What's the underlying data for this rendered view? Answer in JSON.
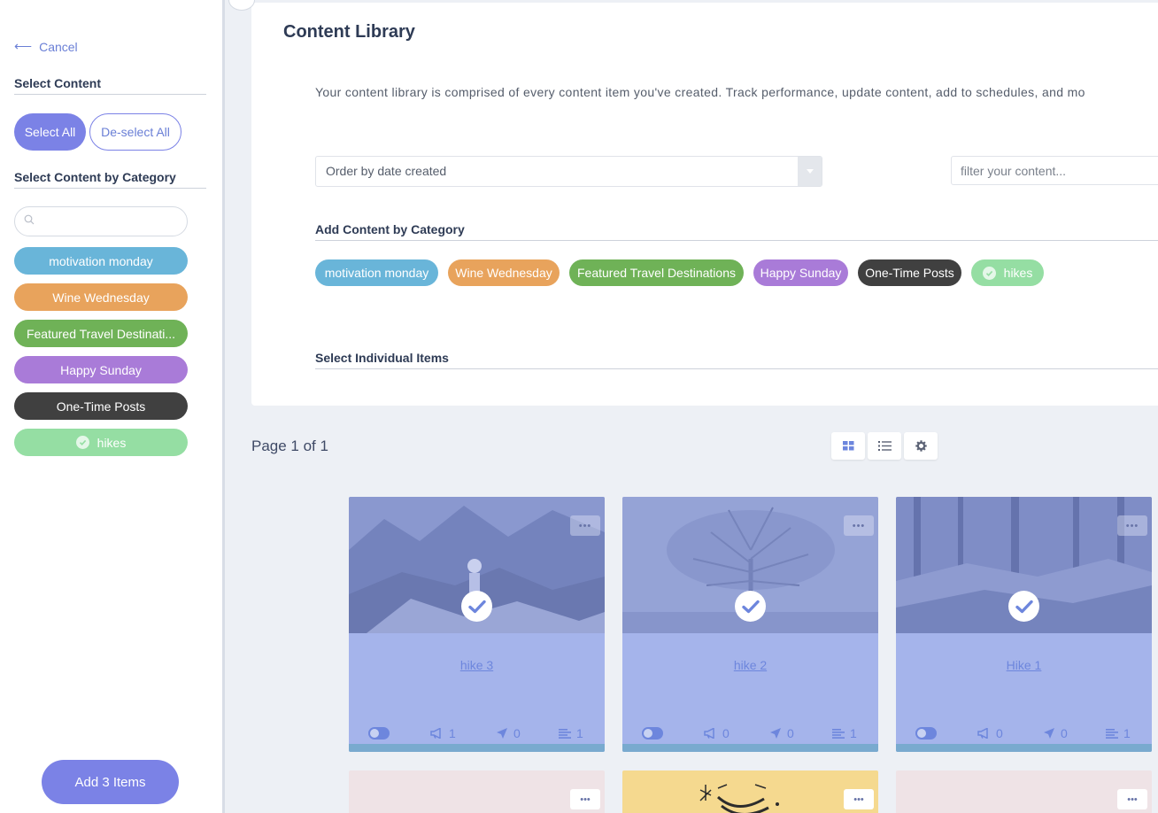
{
  "sidebar": {
    "cancel_label": "Cancel",
    "select_content_heading": "Select Content",
    "select_all_label": "Select All",
    "deselect_all_label": "De-select All",
    "by_category_heading": "Select Content by Category",
    "search_placeholder": "",
    "categories": [
      {
        "label": "motivation monday",
        "color": "#69b5d9"
      },
      {
        "label": "Wine Wednesday",
        "color": "#e8a35c"
      },
      {
        "label": "Featured Travel Destinati...",
        "color": "#6fb257"
      },
      {
        "label": "Happy Sunday",
        "color": "#a97bd8"
      },
      {
        "label": "One-Time Posts",
        "color": "#404040"
      },
      {
        "label": "hikes",
        "color": "#95dea3",
        "checked": true
      }
    ],
    "add_button_label": "Add 3 Items"
  },
  "main": {
    "title": "Content Library",
    "description": "Your content library is comprised of every content item you've created. Track performance, update content, add to schedules, and mo",
    "order_select_value": "Order by date created",
    "filter_placeholder": "filter your content...",
    "add_by_category_heading": "Add Content by Category",
    "categories": [
      {
        "label": "motivation monday",
        "color": "#69b5d9"
      },
      {
        "label": "Wine Wednesday",
        "color": "#e8a35c"
      },
      {
        "label": "Featured Travel Destinations",
        "color": "#6fb257"
      },
      {
        "label": "Happy Sunday",
        "color": "#a97bd8"
      },
      {
        "label": "One-Time Posts",
        "color": "#404040"
      },
      {
        "label": "hikes",
        "color": "#95dea3",
        "checked": true
      }
    ],
    "individual_items_heading": "Select Individual Items"
  },
  "pagination": {
    "page_info": "Page 1 of 1",
    "views": [
      "grid-view-icon",
      "list-view-icon",
      "gear-icon"
    ]
  },
  "cards": [
    {
      "name": "hike 3",
      "menu": "•••",
      "boosts": "1",
      "sends": "0",
      "items": "1",
      "selected": true
    },
    {
      "name": "hike 2",
      "menu": "•••",
      "boosts": "0",
      "sends": "0",
      "items": "1",
      "selected": true
    },
    {
      "name": "Hike 1",
      "menu": "•••",
      "boosts": "0",
      "sends": "0",
      "items": "1",
      "selected": true
    }
  ],
  "lower_cards_menu": "•••",
  "colors": {
    "accent": "#7b82e6",
    "selected_overlay": "#a5b4eb",
    "link": "#6d86dd"
  }
}
